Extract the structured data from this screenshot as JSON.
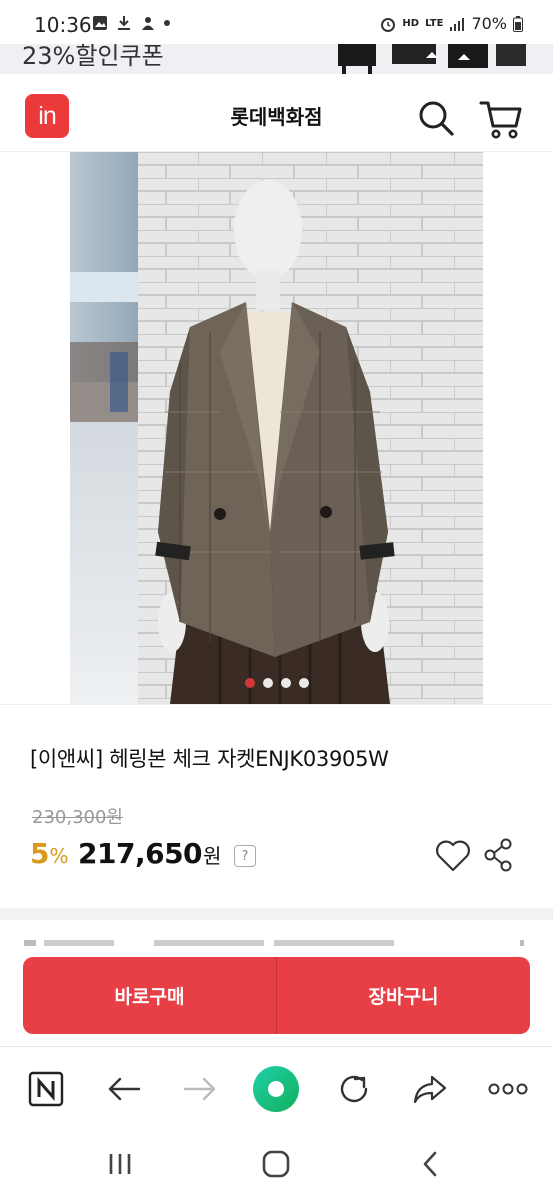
{
  "status_bar": {
    "time": "10:36",
    "network_labels": [
      "HD",
      "LTE"
    ],
    "battery": "70%"
  },
  "ad_banner": {
    "text": "23%할인쿠폰"
  },
  "header": {
    "logo_text": "in",
    "title": "롯데백화점",
    "icons": [
      "search-icon",
      "cart-icon"
    ]
  },
  "gallery": {
    "slide_count": 4,
    "active_index": 0
  },
  "product": {
    "name": "[이앤씨] 헤링본 체크 자켓ENJK03905W",
    "original_price": "230,300원",
    "discount_rate": "5",
    "discount_unit": "%",
    "sale_price": "217,650",
    "currency": "원",
    "help_label": "?"
  },
  "purchase": {
    "buy_now_label": "바로구매",
    "cart_label": "장바구니"
  },
  "browser_toolbar": {
    "items": [
      "naver-icon",
      "back-icon",
      "forward-icon",
      "home-icon",
      "refresh-icon",
      "share-icon",
      "more-icon"
    ]
  },
  "system_nav": {
    "items": [
      "recent-apps-icon",
      "home-icon",
      "back-icon"
    ]
  },
  "colors": {
    "brand": "#ea3a3a",
    "purchase_bar": "#e83e45",
    "discount": "#d99a1c",
    "home_gradient_start": "#1fd0a8",
    "home_gradient_end": "#13b05e"
  }
}
